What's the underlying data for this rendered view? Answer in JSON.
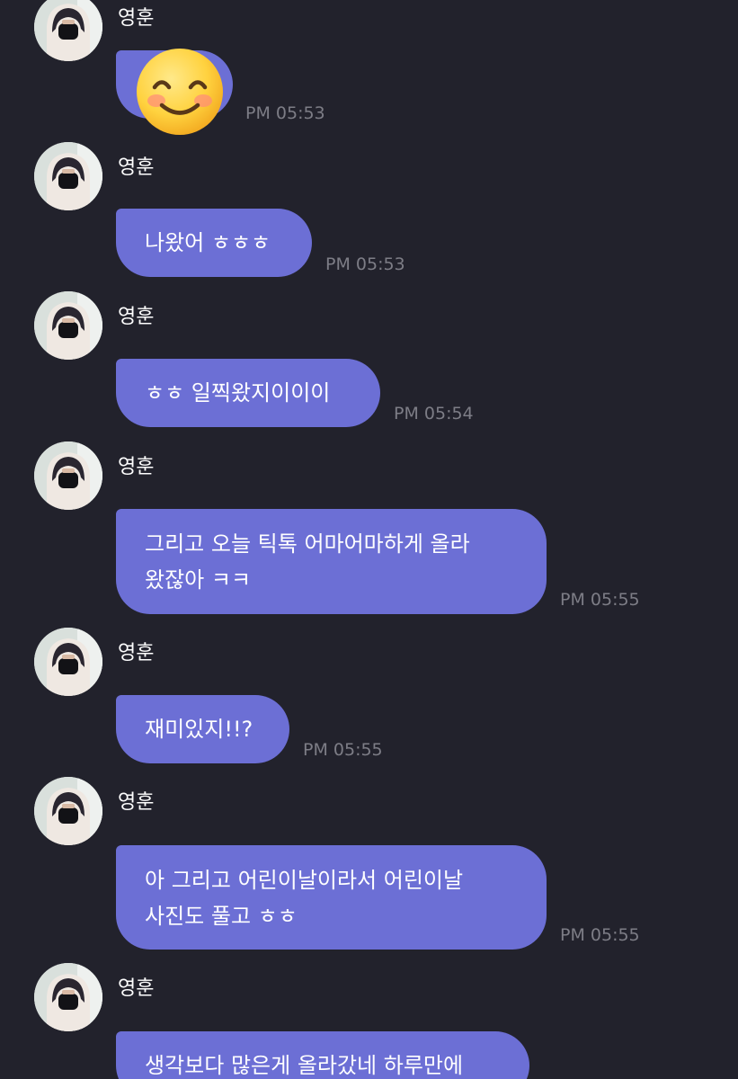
{
  "messages": [
    {
      "sender": "영훈",
      "type": "emoji",
      "emoji": "smiling-face-with-smiling-eyes",
      "time": "PM 05:53"
    },
    {
      "sender": "영훈",
      "type": "text",
      "lines": [
        "나왔어 ㅎㅎㅎ"
      ],
      "time": "PM 05:53"
    },
    {
      "sender": "영훈",
      "type": "text",
      "lines": [
        "ㅎㅎ 일찍왔지이이이"
      ],
      "time": "PM 05:54"
    },
    {
      "sender": "영훈",
      "type": "text",
      "lines": [
        "그리고 오늘 틱톡 어마어마하게 올라",
        "왔잖아 ㅋㅋ"
      ],
      "time": "PM 05:55"
    },
    {
      "sender": "영훈",
      "type": "text",
      "lines": [
        "재미있지!!?"
      ],
      "time": "PM 05:55"
    },
    {
      "sender": "영훈",
      "type": "text",
      "lines": [
        "아 그리고 어린이날이라서 어린이날",
        "사진도 풀고 ㅎㅎ"
      ],
      "time": "PM 05:55"
    },
    {
      "sender": "영훈",
      "type": "text",
      "lines": [
        "생각보다 많은게 올라갔네 하루만에"
      ],
      "time": ""
    }
  ],
  "colors": {
    "background": "#22222c",
    "bubble": "#6c6fd5",
    "timestamp": "#7d7d86",
    "text": "#ffffff"
  }
}
